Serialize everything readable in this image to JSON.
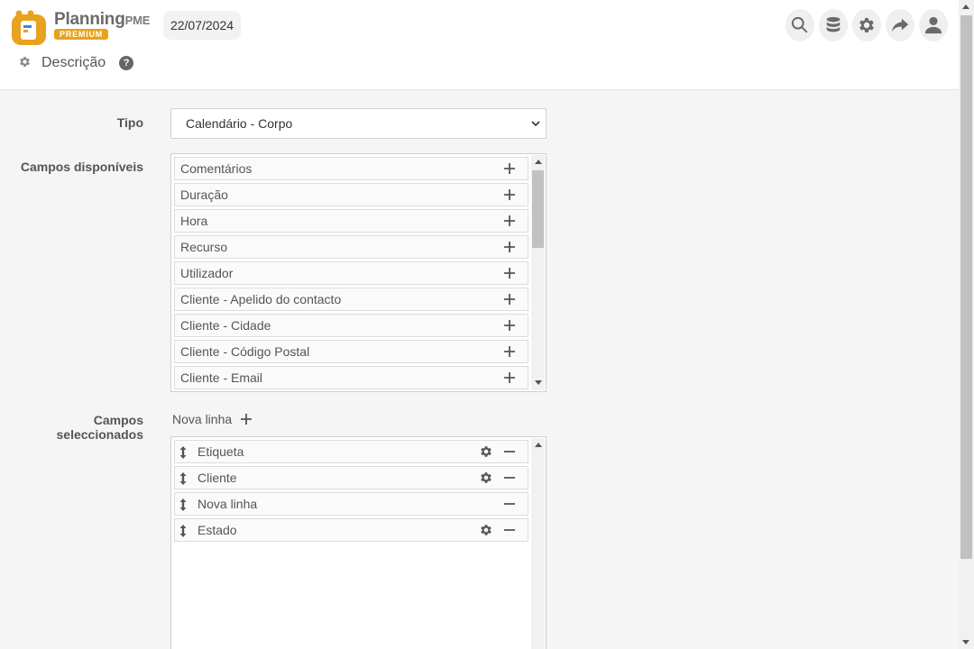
{
  "app": {
    "logo_word": "Planning",
    "logo_suffix": "PME",
    "logo_badge": "PREMIUM",
    "brand_color": "#e8a21e"
  },
  "header": {
    "date": "22/07/2024",
    "icons": [
      "search-icon",
      "database-icon",
      "gear-icon",
      "share-icon",
      "user-icon"
    ]
  },
  "page": {
    "title": "Descrição",
    "help": "?"
  },
  "form": {
    "tipo_label": "Tipo",
    "tipo_value": "Calendário - Corpo",
    "available_label": "Campos disponíveis",
    "available": [
      "Comentários",
      "Duração",
      "Hora",
      "Recurso",
      "Utilizador",
      "Cliente - Apelido do contacto",
      "Cliente - Cidade",
      "Cliente - Código Postal",
      "Cliente - Email"
    ],
    "selected_label": "Campos seleccionados",
    "new_line_label": "Nova linha",
    "selected": [
      "Etiqueta",
      "Cliente",
      "Nova linha",
      "Estado"
    ]
  }
}
